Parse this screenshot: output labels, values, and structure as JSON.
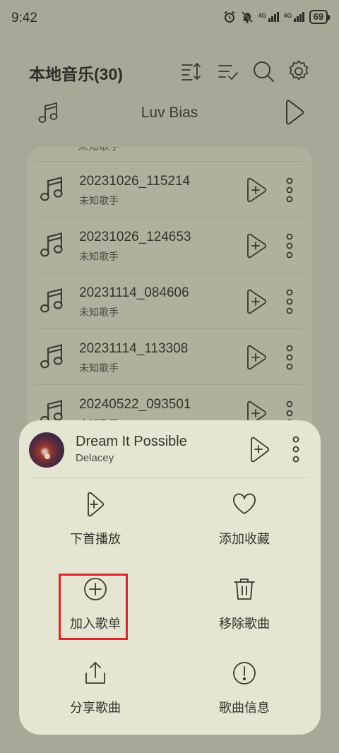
{
  "status_bar": {
    "time": "9:42",
    "net1": "4G",
    "net2": "4G",
    "battery": "69"
  },
  "header": {
    "title": "本地音乐(30)",
    "icons": [
      "sort-icon",
      "multi-select-icon",
      "search-icon",
      "settings-icon"
    ]
  },
  "now_playing": {
    "title": "Luv Bias"
  },
  "list": {
    "cut_text": "未知歌手",
    "songs": [
      {
        "name": "20231026_115214",
        "artist": "未知歌手"
      },
      {
        "name": "20231026_124653",
        "artist": "未知歌手"
      },
      {
        "name": "20231114_084606",
        "artist": "未知歌手"
      },
      {
        "name": "20231114_113308",
        "artist": "未知歌手"
      },
      {
        "name": "20240522_093501",
        "artist": "未知歌手"
      }
    ]
  },
  "sheet": {
    "song_title": "Dream It Possible",
    "song_artist": "Delacey",
    "actions": {
      "play_next": "下首播放",
      "favorite": "添加收藏",
      "add_playlist": "加入歌单",
      "remove": "移除歌曲",
      "share": "分享歌曲",
      "info": "歌曲信息"
    }
  },
  "colors": {
    "background": "#a9a898",
    "sheet": "#e6e5d3",
    "highlight": "#e0242a",
    "text": "#3d3c33"
  }
}
